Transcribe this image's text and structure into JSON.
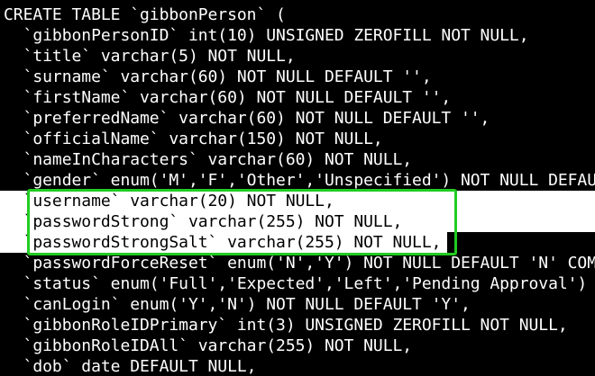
{
  "terminal": {
    "lines": [
      "CREATE TABLE `gibbonPerson` (",
      "  `gibbonPersonID` int(10) UNSIGNED ZEROFILL NOT NULL,",
      "  `title` varchar(5) NOT NULL,",
      "  `surname` varchar(60) NOT NULL DEFAULT '',",
      "  `firstName` varchar(60) NOT NULL DEFAULT '',",
      "  `preferredName` varchar(60) NOT NULL DEFAULT '',",
      "  `officialName` varchar(150) NOT NULL,",
      "  `nameInCharacters` varchar(60) NOT NULL,",
      "  `gender` enum('M','F','Other','Unspecified') NOT NULL DEFAULT",
      "  `username` varchar(20) NOT NULL,",
      "  `passwordStrong` varchar(255) NOT NULL,",
      "  `passwordStrongSalt` varchar(255) NOT NULL,",
      "  `passwordForceReset` enum('N','Y') NOT NULL DEFAULT 'N' COMMENT",
      "  `status` enum('Full','Expected','Left','Pending Approval') NOT NULL",
      "  `canLogin` enum('Y','N') NOT NULL DEFAULT 'Y',",
      "  `gibbonRoleIDPrimary` int(3) UNSIGNED ZEROFILL NOT NULL,",
      "  `gibbonRoleIDAll` varchar(255) NOT NULL,",
      "  `dob` date DEFAULT NULL,"
    ]
  },
  "colors": {
    "background": "#000000",
    "text": "#ffffff",
    "selection_bg": "#ffffff",
    "selection_text": "#000000",
    "highlight_box": "#22cc22"
  }
}
